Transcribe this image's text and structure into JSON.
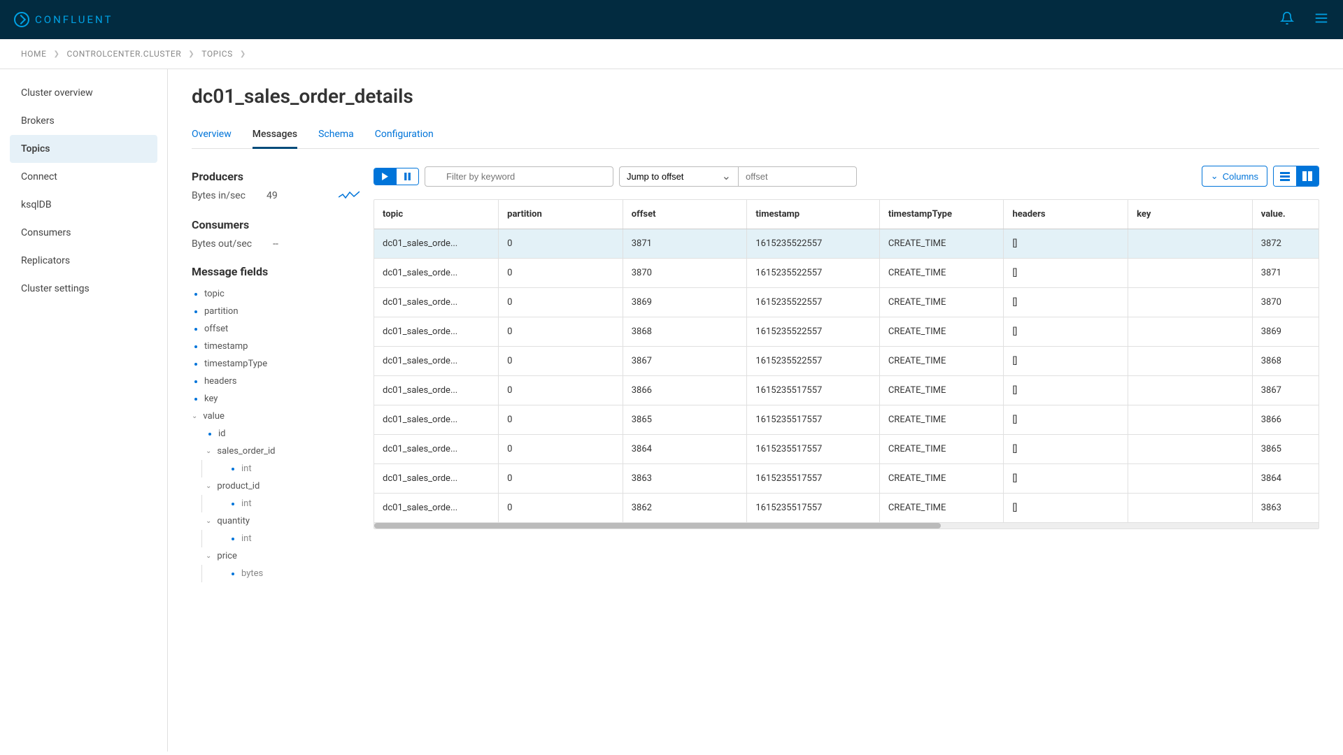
{
  "brand": "CONFLUENT",
  "breadcrumb": [
    "HOME",
    "CONTROLCENTER.CLUSTER",
    "TOPICS"
  ],
  "sidebar": {
    "items": [
      {
        "label": "Cluster overview"
      },
      {
        "label": "Brokers"
      },
      {
        "label": "Topics",
        "active": true
      },
      {
        "label": "Connect"
      },
      {
        "label": "ksqlDB"
      },
      {
        "label": "Consumers"
      },
      {
        "label": "Replicators"
      },
      {
        "label": "Cluster settings"
      }
    ]
  },
  "page": {
    "title": "dc01_sales_order_details",
    "tabs": [
      {
        "label": "Overview"
      },
      {
        "label": "Messages",
        "active": true
      },
      {
        "label": "Schema"
      },
      {
        "label": "Configuration"
      }
    ]
  },
  "producers": {
    "title": "Producers",
    "stat_label": "Bytes in/sec",
    "stat_value": "49"
  },
  "consumers": {
    "title": "Consumers",
    "stat_label": "Bytes out/sec",
    "stat_value": "--"
  },
  "messageFields": {
    "title": "Message fields",
    "top": [
      "topic",
      "partition",
      "offset",
      "timestamp",
      "timestampType",
      "headers",
      "key"
    ],
    "valueField": "value",
    "sub": [
      {
        "name": "id"
      },
      {
        "name": "sales_order_id",
        "type": "int"
      },
      {
        "name": "product_id",
        "type": "int"
      },
      {
        "name": "quantity",
        "type": "int"
      },
      {
        "name": "price",
        "type": "bytes"
      }
    ]
  },
  "toolbar": {
    "filter_placeholder": "Filter by keyword",
    "jump_label": "Jump to offset",
    "offset_placeholder": "offset",
    "columns_label": "Columns"
  },
  "table": {
    "columns": [
      "topic",
      "partition",
      "offset",
      "timestamp",
      "timestampType",
      "headers",
      "key",
      "value."
    ],
    "rows": [
      {
        "topic": "dc01_sales_orde...",
        "partition": "0",
        "offset": "3871",
        "timestamp": "1615235522557",
        "timestampType": "CREATE_TIME",
        "headers": "[]",
        "key": "",
        "value": "3872",
        "selected": true
      },
      {
        "topic": "dc01_sales_orde...",
        "partition": "0",
        "offset": "3870",
        "timestamp": "1615235522557",
        "timestampType": "CREATE_TIME",
        "headers": "[]",
        "key": "",
        "value": "3871"
      },
      {
        "topic": "dc01_sales_orde...",
        "partition": "0",
        "offset": "3869",
        "timestamp": "1615235522557",
        "timestampType": "CREATE_TIME",
        "headers": "[]",
        "key": "",
        "value": "3870"
      },
      {
        "topic": "dc01_sales_orde...",
        "partition": "0",
        "offset": "3868",
        "timestamp": "1615235522557",
        "timestampType": "CREATE_TIME",
        "headers": "[]",
        "key": "",
        "value": "3869"
      },
      {
        "topic": "dc01_sales_orde...",
        "partition": "0",
        "offset": "3867",
        "timestamp": "1615235522557",
        "timestampType": "CREATE_TIME",
        "headers": "[]",
        "key": "",
        "value": "3868"
      },
      {
        "topic": "dc01_sales_orde...",
        "partition": "0",
        "offset": "3866",
        "timestamp": "1615235517557",
        "timestampType": "CREATE_TIME",
        "headers": "[]",
        "key": "",
        "value": "3867"
      },
      {
        "topic": "dc01_sales_orde...",
        "partition": "0",
        "offset": "3865",
        "timestamp": "1615235517557",
        "timestampType": "CREATE_TIME",
        "headers": "[]",
        "key": "",
        "value": "3866"
      },
      {
        "topic": "dc01_sales_orde...",
        "partition": "0",
        "offset": "3864",
        "timestamp": "1615235517557",
        "timestampType": "CREATE_TIME",
        "headers": "[]",
        "key": "",
        "value": "3865"
      },
      {
        "topic": "dc01_sales_orde...",
        "partition": "0",
        "offset": "3863",
        "timestamp": "1615235517557",
        "timestampType": "CREATE_TIME",
        "headers": "[]",
        "key": "",
        "value": "3864"
      },
      {
        "topic": "dc01_sales_orde...",
        "partition": "0",
        "offset": "3862",
        "timestamp": "1615235517557",
        "timestampType": "CREATE_TIME",
        "headers": "[]",
        "key": "",
        "value": "3863"
      }
    ]
  }
}
